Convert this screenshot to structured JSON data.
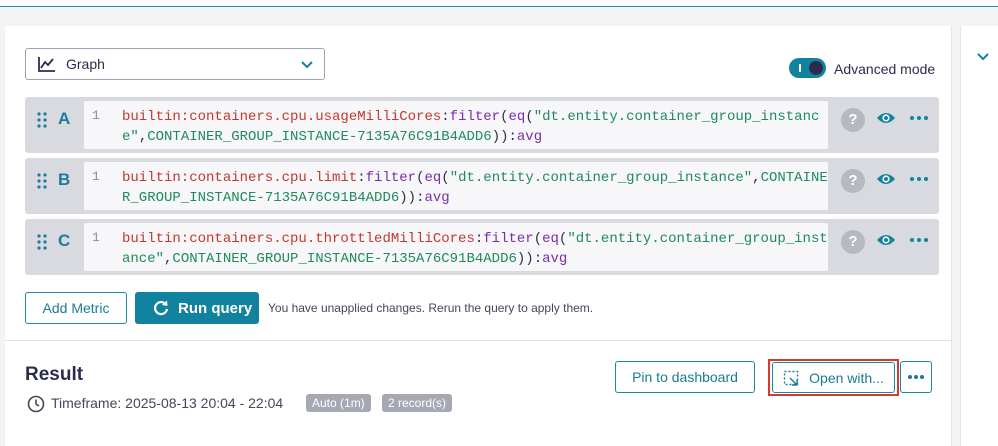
{
  "graph_select": {
    "icon": "line-chart-icon",
    "label": "Graph"
  },
  "advanced_mode": {
    "label": "Advanced mode",
    "on": true
  },
  "queries": [
    {
      "letter": "A",
      "line": "1",
      "metric": "builtin:containers.cpu.usageMilliCores",
      "sep1": ":",
      "fn1": "filter",
      "open1": "(",
      "fn2": "eq",
      "open2": "(",
      "str1": "\"dt.entity.container_group_instance\"",
      "comma": ",",
      "str2": "CONTAINER_GROUP_INSTANCE-7135A76C91B4ADD6",
      "close": "))",
      "sep2": ":",
      "agg": "avg"
    },
    {
      "letter": "B",
      "line": "1",
      "metric": "builtin:containers.cpu.limit",
      "sep1": ":",
      "fn1": "filter",
      "open1": "(",
      "fn2": "eq",
      "open2": "(",
      "str1": "\"dt.entity.container_group_instance\"",
      "comma": ",",
      "str2": "CONTAINER_GROUP_INSTANCE-7135A76C91B4ADD6",
      "close": "))",
      "sep2": ":",
      "agg": "avg"
    },
    {
      "letter": "C",
      "line": "1",
      "metric": "builtin:containers.cpu.throttledMilliCores",
      "sep1": ":",
      "fn1": "filter",
      "open1": "(",
      "fn2": "eq",
      "open2": "(",
      "str1": "\"dt.entity.container_group_instance\"",
      "comma": ",",
      "str2": "CONTAINER_GROUP_INSTANCE-7135A76C91B4ADD6",
      "close": "))",
      "sep2": ":",
      "agg": "avg"
    }
  ],
  "row_actions": {
    "help": "?",
    "icons": [
      "help-icon",
      "eye-icon",
      "more-icon"
    ]
  },
  "actions": {
    "add_metric": "Add Metric",
    "run_query": "Run query",
    "unapplied": "You have unapplied changes. Rerun the query to apply them."
  },
  "result": {
    "title": "Result",
    "timeframe": "Timeframe: 2025-08-13 20:04 - 22:04",
    "badge_auto": "Auto (1m)",
    "badge_records": "2 record(s)",
    "pin_label": "Pin to dashboard",
    "open_label": "Open with...",
    "more_icon": "more-icon"
  },
  "colors": {
    "accent": "#12839e",
    "highlight": "#d93a2b"
  }
}
